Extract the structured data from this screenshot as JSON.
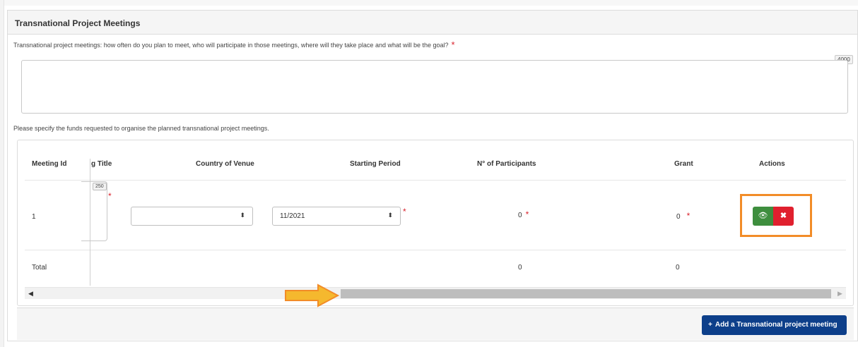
{
  "section": {
    "title": "Transnational Project Meetings"
  },
  "question": {
    "label": "Transnational project meetings: how often do you plan to meet, who will participate in those meetings, where will they take place and what will be the goal?",
    "required_mark": "*",
    "char_limit": "4000",
    "value": ""
  },
  "funds_label": "Please specify the funds requested to organise the planned transnational project meetings.",
  "table": {
    "headers": {
      "meeting_id": "Meeting Id",
      "meeting_title": "g Title",
      "country": "Country of Venue",
      "starting_period": "Starting Period",
      "participants": "N° of Participants",
      "grant": "Grant",
      "actions": "Actions"
    },
    "rows": [
      {
        "meeting_id": "1",
        "title_char_limit": "250",
        "country_value": "",
        "starting_period_value": "11/2021",
        "participants": "0",
        "grant": "0"
      }
    ],
    "total": {
      "label": "Total",
      "participants": "0",
      "grant": "0"
    },
    "required_mark": "*"
  },
  "icons": {
    "select_caret": "⬍",
    "view": "👁",
    "delete": "✖",
    "scroll_left": "◀",
    "scroll_right": "▶",
    "plus": "+"
  },
  "colors": {
    "view_button": "#3e8e3e",
    "delete_button": "#e0202e",
    "highlight": "#f28c28",
    "arrow": "#f5b82e",
    "primary_button": "#0d3f8a",
    "required": "#d9232d"
  },
  "add_button": {
    "label": "Add a Transnational project meeting"
  }
}
